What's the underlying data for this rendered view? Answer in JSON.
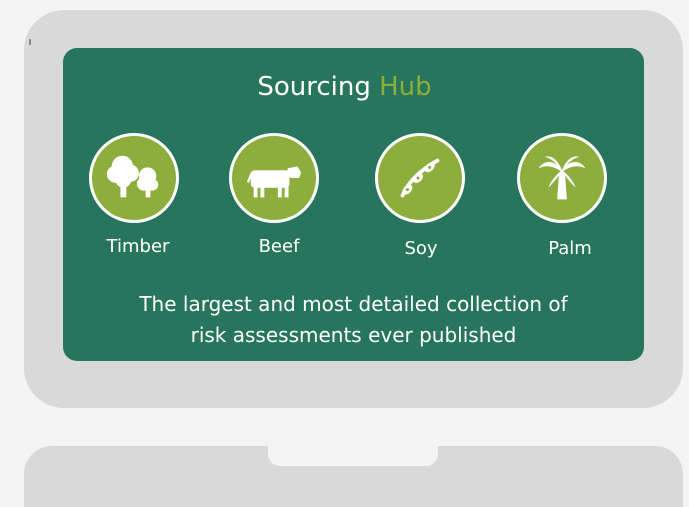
{
  "hub": {
    "title_main": "Sourcing",
    "title_accent": "Hub",
    "tagline_line1": "The largest and most detailed collection of",
    "tagline_line2": "risk assessments ever published"
  },
  "categories": [
    {
      "label": "Timber",
      "icon": "trees-icon"
    },
    {
      "label": "Beef",
      "icon": "cow-icon"
    },
    {
      "label": "Soy",
      "icon": "soybean-icon"
    },
    {
      "label": "Palm",
      "icon": "palm-tree-icon"
    }
  ],
  "colors": {
    "screen_green": "#27755c",
    "accent_green": "#8dae3c",
    "device_grey": "#d9d9d9",
    "text": "#ffffff"
  }
}
